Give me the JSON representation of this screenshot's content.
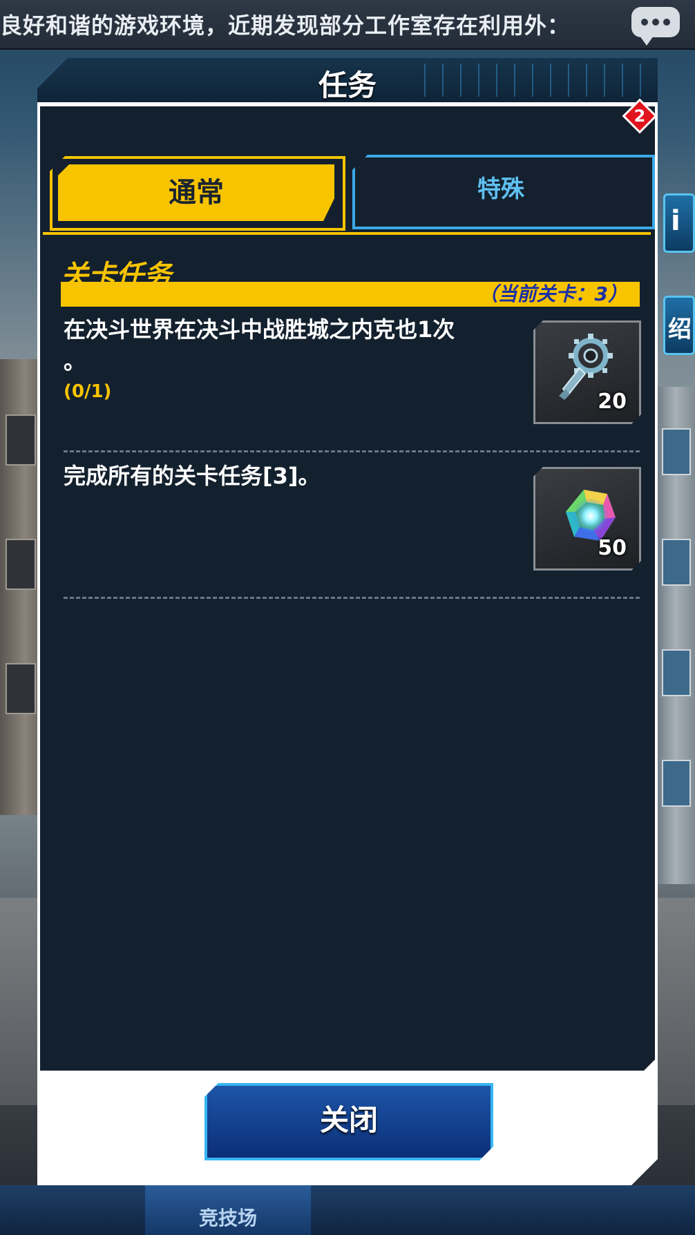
{
  "ticker": {
    "text": "良好和谐的游戏环境，近期发现部分工作室存在利用外："
  },
  "modal": {
    "title": "任务",
    "tabs": {
      "normal": "通常",
      "special": "特殊",
      "special_badge": "2"
    },
    "section": {
      "title": "关卡任务",
      "current_stage": "（当前关卡：3）"
    },
    "quests": [
      {
        "desc_line1": "在决斗世界在决斗中战胜城之内克也1次",
        "desc_line2": "。",
        "progress": "(0/1)",
        "reward_icon": "key-icon",
        "reward_count": "20"
      },
      {
        "desc_line1": "完成所有的关卡任务[3]。",
        "reward_icon": "gem-icon",
        "reward_count": "50"
      }
    ],
    "close_label": "关闭"
  },
  "background": {
    "side_right_label1": "i",
    "side_right_label2": "绍"
  },
  "bottom_nav": {
    "arena_label": "竞技场"
  },
  "colors": {
    "accent_yellow": "#f8c400",
    "panel_dark": "#13202e",
    "tab_blue": "#3aa9e6",
    "badge_red": "#e0141e"
  }
}
